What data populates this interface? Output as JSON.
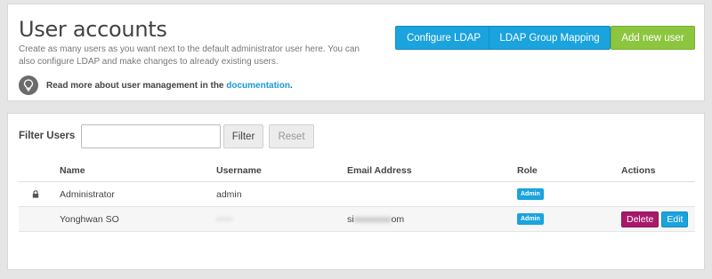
{
  "header": {
    "title": "User accounts",
    "intro": "Create as many users as you want next to the default administrator user here. You can also configure LDAP and make changes to already existing users.",
    "info_text": "Read more about user management in the ",
    "info_link": "documentation",
    "info_suffix": "."
  },
  "toolbar": {
    "configure_ldap": "Configure LDAP",
    "ldap_group_mapping": "LDAP Group Mapping",
    "add_new_user": "Add new user"
  },
  "filter": {
    "label": "Filter Users",
    "value": "",
    "placeholder": "",
    "filter_button": "Filter",
    "reset_button": "Reset"
  },
  "table": {
    "columns": [
      "Name",
      "Username",
      "Email Address",
      "Role",
      "Actions"
    ],
    "rows": [
      {
        "locked": true,
        "name": "Administrator",
        "username": "admin",
        "email": "",
        "role": "Admin",
        "actions": []
      },
      {
        "locked": false,
        "name": "Yonghwan SO",
        "username": "~~~",
        "email_prefix": "si",
        "email_hidden": "xxxxxxxx",
        "email_suffix": "om",
        "role": "Admin",
        "actions": [
          "Delete",
          "Edit"
        ]
      }
    ]
  },
  "colors": {
    "accent_blue": "#1ba3dd",
    "accent_green": "#8cc63f",
    "delete_magenta": "#a8196a"
  },
  "icons": {
    "info": "lightbulb-icon",
    "lock": "lock-icon"
  }
}
